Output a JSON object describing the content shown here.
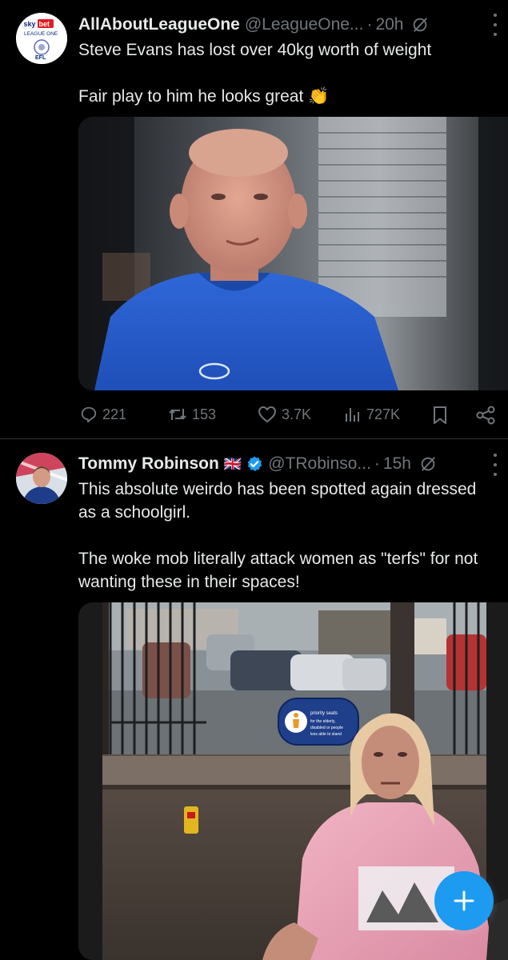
{
  "tweets": [
    {
      "name": "AllAboutLeagueOne",
      "handle": "@LeagueOne...",
      "time": "20h",
      "avatar_icon": "league-one-logo",
      "avatar_text": {
        "brand1": "sky",
        "brand2": "bet",
        "league": "LEAGUE ONE",
        "efl": "EFL"
      },
      "text": [
        "Steve Evans has lost over 40kg worth of weight",
        "",
        "Fair play to him he looks great 👏"
      ],
      "media": "photo of a bald man in a blue sports shirt being interviewed in front of window blinds",
      "actions": {
        "replies": "221",
        "reposts": "153",
        "likes": "3.7K",
        "views": "727K"
      }
    },
    {
      "name": "Tommy Robinson",
      "flag": "🇬🇧",
      "verified": true,
      "handle": "@TRobinso...",
      "time": "15h",
      "avatar_icon": "profile-photo",
      "text": [
        "This absolute weirdo has been spotted again dressed as a schoolgirl.",
        "",
        "The woke mob literally attack women as \"terfs\" for not wanting these in their spaces!"
      ],
      "media": "photo of a person in a pink hoodie seated on a bus beside a window showing a car park",
      "sign": {
        "line1": "priority seats",
        "line2": "for the elderly,",
        "line3": "disabled or people",
        "line4": "less able to stand"
      }
    }
  ],
  "fab": {
    "label": "+",
    "icon": "plus-icon"
  },
  "colors": {
    "background": "#000000",
    "text": "#e7e9ea",
    "muted": "#71767b",
    "accent": "#1d9bf0",
    "verified": "#1d9bf0"
  }
}
